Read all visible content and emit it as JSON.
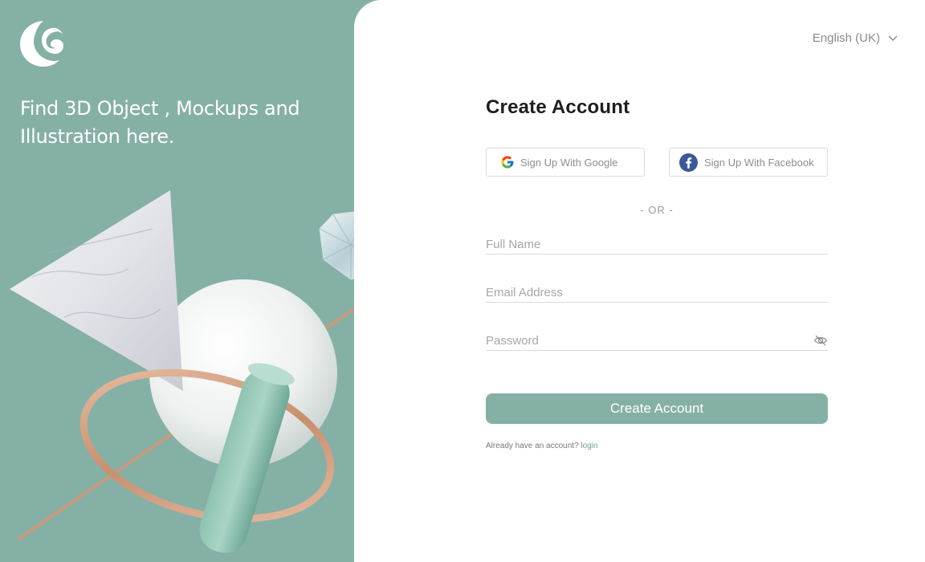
{
  "brand": {
    "logo_icon": "crescent-logo-icon",
    "tagline_line1": "Find  3D Object , Mockups and",
    "tagline_line2": "Illustration here.",
    "accent_color": "#85b0a6"
  },
  "header": {
    "language": "English (UK)"
  },
  "form": {
    "title": "Create Account",
    "google_label": "Sign Up With Google",
    "facebook_label": "Sign Up With Facebook",
    "or_label": "-  OR  -",
    "full_name": {
      "value": "",
      "placeholder": "Full Name"
    },
    "email": {
      "value": "",
      "placeholder": "Email Address"
    },
    "password": {
      "value": "",
      "placeholder": "Password"
    },
    "submit_label": "Create Account",
    "login_prompt": "Already have an account?",
    "login_link": "login"
  }
}
